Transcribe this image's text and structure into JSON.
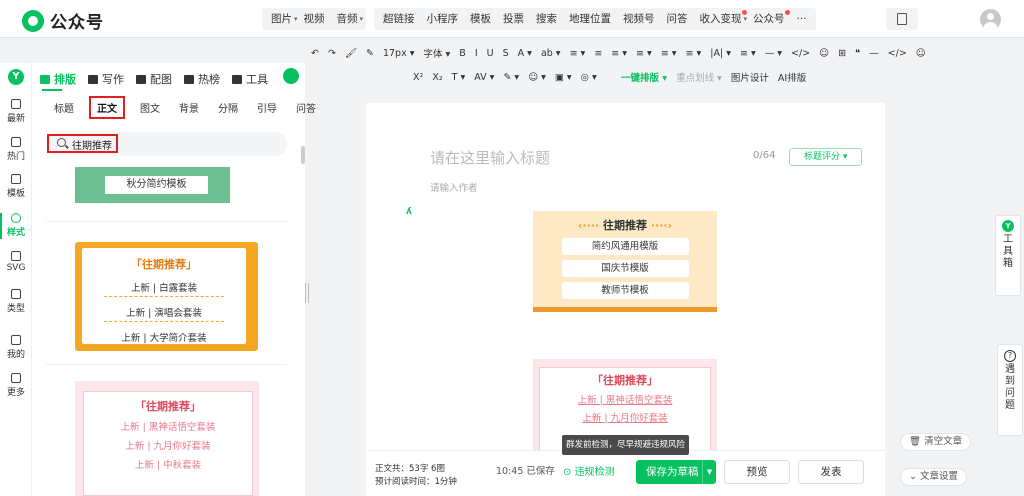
{
  "app": {
    "name": "公众号"
  },
  "topnav": {
    "groups": [
      [
        {
          "label": "图片",
          "dd": true
        },
        {
          "label": "视频"
        },
        {
          "label": "音频",
          "dd": true
        }
      ],
      [
        {
          "label": "超链接"
        },
        {
          "label": "小程序"
        },
        {
          "label": "模板"
        },
        {
          "label": "投票"
        },
        {
          "label": "搜索"
        },
        {
          "label": "地理位置"
        },
        {
          "label": "视频号"
        },
        {
          "label": "问答"
        },
        {
          "label": "收入变现",
          "dd": true,
          "dot": true
        },
        {
          "label": "公众号",
          "dot": true
        },
        {
          "label": "···"
        }
      ]
    ]
  },
  "leftrail": {
    "items": [
      "最新",
      "热门",
      "模板",
      "样式",
      "SVG",
      "类型",
      "我的",
      "更多"
    ],
    "active": "样式"
  },
  "panel": {
    "tabs": [
      "排版",
      "写作",
      "配图",
      "热榜",
      "工具"
    ],
    "active_tab": "排版",
    "subtabs": [
      "标题",
      "正文",
      "图文",
      "背景",
      "分隔",
      "引导",
      "问答"
    ],
    "active_subtab": "正文",
    "search_value": "往期推荐",
    "templates": {
      "t1": "秋分简约模板",
      "t2_title": "「往期推荐」",
      "t2_lines": [
        "上新 | 白露套装",
        "上新 | 演唱会套装",
        "上新 | 大学简介套装"
      ],
      "t3_title": "「往期推荐」",
      "t3_lines": [
        "上新 | 黑神话悟空套装",
        "上新 | 九月你好套装",
        "上新 | 中秋套装"
      ]
    }
  },
  "toolbar": {
    "row1": [
      "↶",
      "↷",
      "🖌",
      "✎",
      "17px ▾",
      "字体 ▾",
      "B",
      "I",
      "U",
      "S",
      "A ▾",
      "ab ▾",
      "≡ ▾",
      "≡",
      "≡ ▾",
      "≡ ▾",
      "≡ ▾",
      "≡ ▾",
      "|A| ▾",
      "≡ ▾",
      "— ▾",
      "</>",
      "☺",
      "⊞",
      "❝",
      "—",
      "</>",
      "☺"
    ],
    "row2": [
      "X²",
      "X₂",
      "T ▾",
      "AV ▾",
      "✎ ▾",
      "☺ ▾",
      "▣ ▾",
      "◎ ▾"
    ],
    "one_click": "一键排版 ▾",
    "emphasis": "重点划线 ▾",
    "image_design": "图片设计",
    "ai_layout": "AI排版"
  },
  "editor": {
    "title_placeholder": "请在这里输入标题",
    "title_count": "0/64",
    "score_button": "标题评分 ▾",
    "author_placeholder": "请输入作者",
    "card_or": {
      "title": "往期推荐",
      "left_arrows": "‹····",
      "right_arrows": "····›",
      "items": [
        "简约风通用模版",
        "国庆节模版",
        "教师节模板"
      ]
    },
    "card_pk": {
      "title": "「往期推荐」",
      "lines": [
        "上新 | 黑神话悟空套装",
        "上新 | 九月你好套装"
      ]
    }
  },
  "footer": {
    "word_count_label": "正文共：",
    "word_count_value": "53字 6图",
    "read_time_label": "预计阅读时间：",
    "read_time_value": "1分钟",
    "saved_at": "10:45 已保存",
    "check_label": "违规检测",
    "tooltip": "群发前检测，尽早规避违规风险",
    "save_draft": "保存为草稿",
    "preview": "预览",
    "publish": "发表"
  },
  "right": {
    "tools": [
      "工",
      "具",
      "箱"
    ],
    "help": [
      "遇",
      "到",
      "问",
      "题"
    ],
    "clear": "清空文章",
    "settings": "文章设置"
  }
}
